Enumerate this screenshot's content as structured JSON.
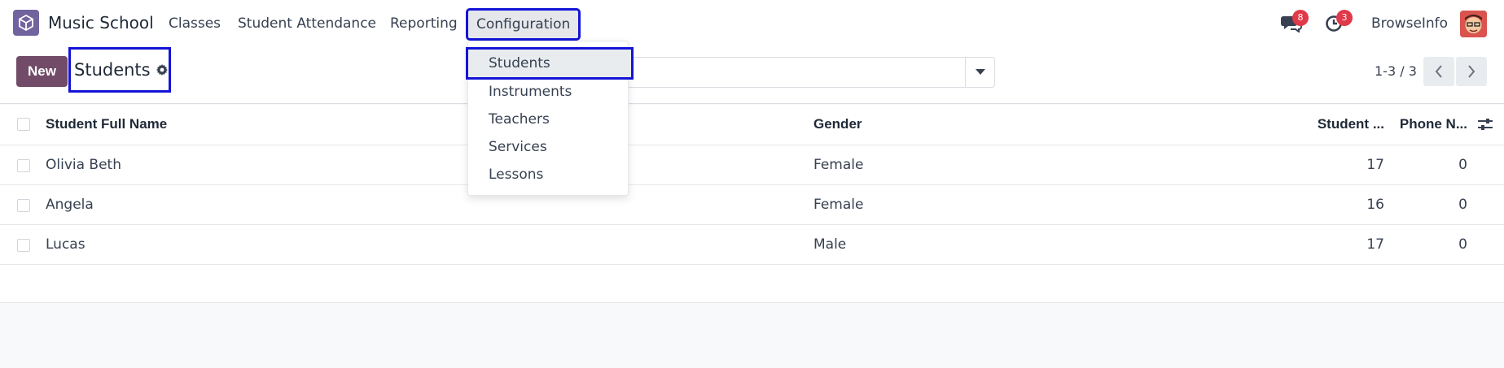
{
  "app": {
    "name": "Music School"
  },
  "nav": {
    "items": [
      {
        "label": "Classes"
      },
      {
        "label": "Student Attendance"
      },
      {
        "label": "Reporting"
      },
      {
        "label": "Configuration"
      }
    ]
  },
  "systray": {
    "messages_count": "8",
    "activities_count": "3",
    "user_name": "BrowseInfo"
  },
  "control": {
    "new_label": "New",
    "breadcrumb_title": "Students",
    "pager_value": "1-3 / 3"
  },
  "table": {
    "columns": [
      "Student Full Name",
      "Gender",
      "Student ...",
      "Phone N..."
    ],
    "rows": [
      {
        "name": "Olivia Beth",
        "gender": "Female",
        "age": "17",
        "phone": "0"
      },
      {
        "name": "Angela",
        "gender": "Female",
        "age": "16",
        "phone": "0"
      },
      {
        "name": "Lucas",
        "gender": "Male",
        "age": "17",
        "phone": "0"
      }
    ]
  },
  "dropdown": {
    "items": [
      {
        "label": "Students"
      },
      {
        "label": "Instruments"
      },
      {
        "label": "Teachers"
      },
      {
        "label": "Services"
      },
      {
        "label": "Lessons"
      }
    ]
  },
  "colors": {
    "brand": "#714b67",
    "app_icon": "#71639e",
    "badge": "#e0394a",
    "highlight": "#1414d6"
  },
  "icons": [
    "app-icon",
    "chat-icon",
    "clock-icon",
    "gear-icon",
    "caret-down-icon",
    "chevron-left-icon",
    "chevron-right-icon",
    "sliders-icon"
  ]
}
